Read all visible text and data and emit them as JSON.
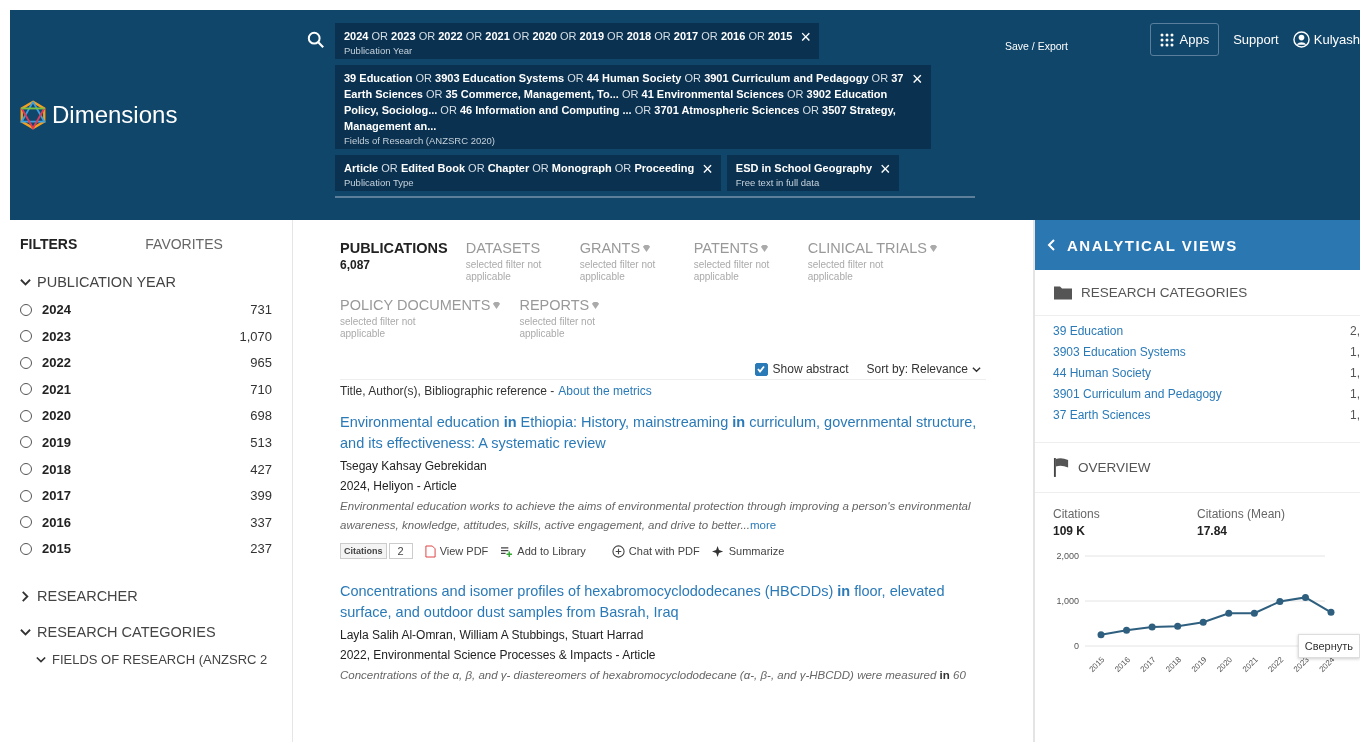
{
  "header": {
    "logo_text": "Dimensions",
    "chip_rows": [
      [
        {
          "text": "**2024** OR **2023** OR **2022** OR **2021** OR **2020** OR **2019** OR **2018** OR **2017** OR **2016** OR **2015**",
          "label": "Publication Year"
        }
      ],
      [
        {
          "text": "**39 Education** OR **3903 Education Systems** OR **44 Human Society** OR **3901 Curriculum and Pedagogy** OR **37 Earth Sciences** OR **35 Commerce, Management, To...** OR **41 Environmental Sciences** OR **3902 Education Policy, Sociolog...** OR **46 Information and Computing ...** OR **3701 Atmospheric Sciences** OR **3507 Strategy, Management an...**",
          "label": "Fields of Research (ANZSRC 2020)"
        }
      ],
      [
        {
          "text": "**Article** OR **Edited Book** OR **Chapter** OR **Monograph** OR **Proceeding**",
          "label": "Publication Type"
        },
        {
          "text": "**ESD in School Geography**",
          "label": "Free text in full data"
        }
      ]
    ],
    "close_glyph": "×",
    "save_export": "Save / Export",
    "apps": "Apps",
    "support": "Support",
    "user": "Kulyash"
  },
  "sidebar": {
    "tabs": [
      {
        "label": "FILTERS",
        "selected": true
      },
      {
        "label": "FAVORITES",
        "selected": false
      }
    ],
    "sections": [
      {
        "title": "PUBLICATION YEAR",
        "expanded": true,
        "options": [
          {
            "label": "2024",
            "count": "731",
            "selected": false
          },
          {
            "label": "2023",
            "count": "1,070",
            "selected": false
          },
          {
            "label": "2022",
            "count": "965",
            "selected": false
          },
          {
            "label": "2021",
            "count": "710",
            "selected": false
          },
          {
            "label": "2020",
            "count": "698",
            "selected": false
          },
          {
            "label": "2019",
            "count": "513",
            "selected": false
          },
          {
            "label": "2018",
            "count": "427",
            "selected": false
          },
          {
            "label": "2017",
            "count": "399",
            "selected": false
          },
          {
            "label": "2016",
            "count": "337",
            "selected": false
          },
          {
            "label": "2015",
            "count": "237",
            "selected": false
          }
        ]
      },
      {
        "title": "RESEARCHER",
        "expanded": false
      },
      {
        "title": "RESEARCH CATEGORIES",
        "expanded": true,
        "sub": "FIELDS OF RESEARCH (ANZSRC 2"
      }
    ]
  },
  "main": {
    "tab_rows": [
      [
        {
          "label": "PUBLICATIONS",
          "sub": "6,087",
          "selected": true,
          "premium": false
        },
        {
          "label": "DATASETS",
          "sub": "selected filter not applicable",
          "selected": false,
          "premium": false
        },
        {
          "label": "GRANTS",
          "sub": "selected filter not applicable",
          "selected": false,
          "premium": true
        },
        {
          "label": "PATENTS",
          "sub": "selected filter not applicable",
          "selected": false,
          "premium": true
        },
        {
          "label": "CLINICAL TRIALS",
          "sub": "selected filter not applicable",
          "selected": false,
          "premium": true
        }
      ],
      [
        {
          "label": "POLICY DOCUMENTS",
          "sub": "selected filter not applicable",
          "selected": false,
          "premium": true
        },
        {
          "label": "REPORTS",
          "sub": "selected filter not applicable",
          "selected": false,
          "premium": true
        }
      ]
    ],
    "show_abstract": {
      "label": "Show abstract",
      "checked": true
    },
    "sort": {
      "label": "Sort by:",
      "value": "Relevance"
    },
    "list_header": "Title, Author(s), Bibliographic reference -",
    "metrics_link": "About the metrics",
    "results": [
      {
        "title": "Environmental education **in** Ethiopia: History, mainstreaming **in** curriculum, governmental structure, and its effectiveness: A systematic review",
        "authors": "Tsegay Kahsay Gebrekidan",
        "source": "2024, Heliyon - Article",
        "abstract": "Environmental education works to achieve the aims of environmental protection through improving a person's environmental awareness, knowledge, attitudes, skills, active engagement, and drive to better...",
        "more": "more",
        "citations_label": "Citations",
        "citations": "2",
        "actions": [
          "View PDF",
          "Add to Library",
          "Chat with PDF",
          "Summarize"
        ]
      },
      {
        "title": "Concentrations and isomer profiles of hexabromocyclododecanes (HBCDDs) **in** floor, elevated surface, and outdoor dust samples from Basrah, Iraq",
        "authors": "Layla Salih Al-Omran, William A Stubbings, Stuart Harrad",
        "source": "2022, Environmental Science Processes & Impacts - Article",
        "abstract": "Concentrations of the α, β, and γ- diastereomers of hexabromocyclododecane (α-, β-, and γ-HBCDD) were measured **in** 60"
      }
    ]
  },
  "analytics": {
    "title": "ANALYTICAL VIEWS",
    "categories_title": "RESEARCH CATEGORIES",
    "categories": [
      {
        "name": "39 Education",
        "count": "2,"
      },
      {
        "name": "3903 Education Systems",
        "count": "1,"
      },
      {
        "name": "44 Human Society",
        "count": "1,"
      },
      {
        "name": "3901 Curriculum and Pedagogy",
        "count": "1,"
      },
      {
        "name": "37 Earth Sciences",
        "count": "1,"
      }
    ],
    "overview_title": "OVERVIEW",
    "stats": [
      {
        "label": "Citations",
        "value": "109 K"
      },
      {
        "label": "Citations (Mean)",
        "value": "17.84"
      }
    ],
    "chart_data": {
      "type": "line",
      "categories": [
        "2015",
        "2016",
        "2017",
        "2018",
        "2019",
        "2020",
        "2021",
        "2022",
        "2023",
        "2024"
      ],
      "series": [
        {
          "color": "#2f5f7f",
          "marker": true,
          "values": [
            250,
            350,
            420,
            440,
            530,
            730,
            730,
            990,
            1080,
            750
          ]
        }
      ],
      "ylim": [
        0,
        2000
      ],
      "yticks": [
        {
          "value": 0,
          "label": "0"
        },
        {
          "value": 1000,
          "label": "1,000"
        },
        {
          "value": 2000,
          "label": "2,000"
        }
      ]
    },
    "tooltip": "Свернуть"
  }
}
